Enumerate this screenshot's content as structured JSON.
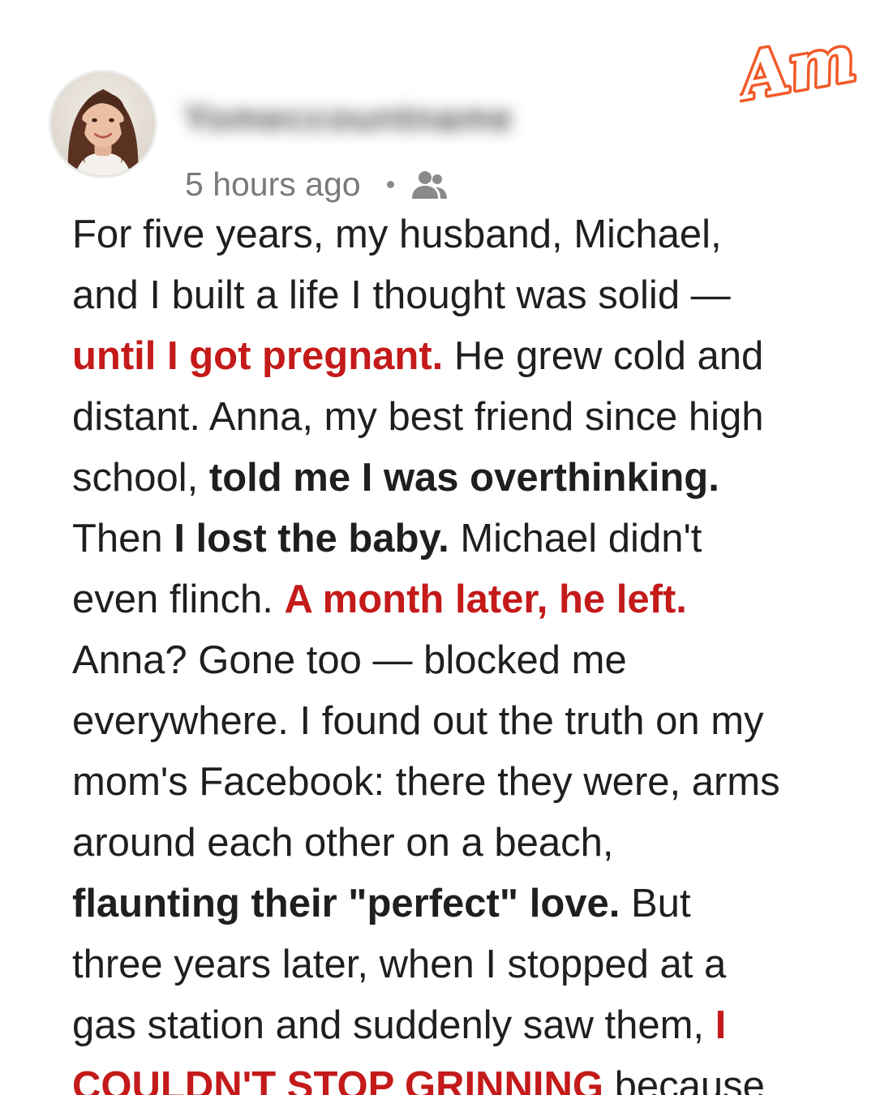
{
  "brand": {
    "logo_text": "Am",
    "logo_color": "#f05a28"
  },
  "post": {
    "username": "Yomeccountname",
    "timestamp": "5 hours ago",
    "separator": "•",
    "audience_icon": "friends-icon",
    "avatar_icon": "user-avatar-photo",
    "accent_color": "#c41a1a",
    "lines": [
      [
        {
          "text": "For five years, my husband, Michael,",
          "style": "normal"
        }
      ],
      [
        {
          "text": "and I built a life I thought was solid —",
          "style": "normal"
        }
      ],
      [
        {
          "text": "until I got pregnant.",
          "style": "red"
        },
        {
          "text": " He grew cold and",
          "style": "normal"
        }
      ],
      [
        {
          "text": "distant. Anna, my best friend since high",
          "style": "normal"
        }
      ],
      [
        {
          "text": "school, ",
          "style": "normal"
        },
        {
          "text": "told me I was overthinking.",
          "style": "bold"
        }
      ],
      [
        {
          "text": "Then ",
          "style": "normal"
        },
        {
          "text": "I lost the baby.",
          "style": "bold"
        },
        {
          "text": " Michael didn't",
          "style": "normal"
        }
      ],
      [
        {
          "text": "even flinch. ",
          "style": "normal"
        },
        {
          "text": "A month later, he left.",
          "style": "red"
        }
      ],
      [
        {
          "text": "Anna? Gone too — blocked me",
          "style": "normal"
        }
      ],
      [
        {
          "text": "everywhere. I found out the truth on my",
          "style": "normal"
        }
      ],
      [
        {
          "text": "mom's Facebook: there they were, arms",
          "style": "normal"
        }
      ],
      [
        {
          "text": "around each other on a beach,",
          "style": "normal"
        }
      ],
      [
        {
          "text": "flaunting their \"perfect\" love.",
          "style": "bold"
        },
        {
          "text": " But",
          "style": "normal"
        }
      ],
      [
        {
          "text": "three years later, when I stopped at a",
          "style": "normal"
        }
      ],
      [
        {
          "text": "gas station and suddenly saw them, ",
          "style": "normal"
        },
        {
          "text": "I",
          "style": "red"
        }
      ],
      [
        {
          "text": "COULDN'T STOP GRINNING",
          "style": "red"
        },
        {
          "text": " because",
          "style": "normal"
        }
      ]
    ]
  }
}
